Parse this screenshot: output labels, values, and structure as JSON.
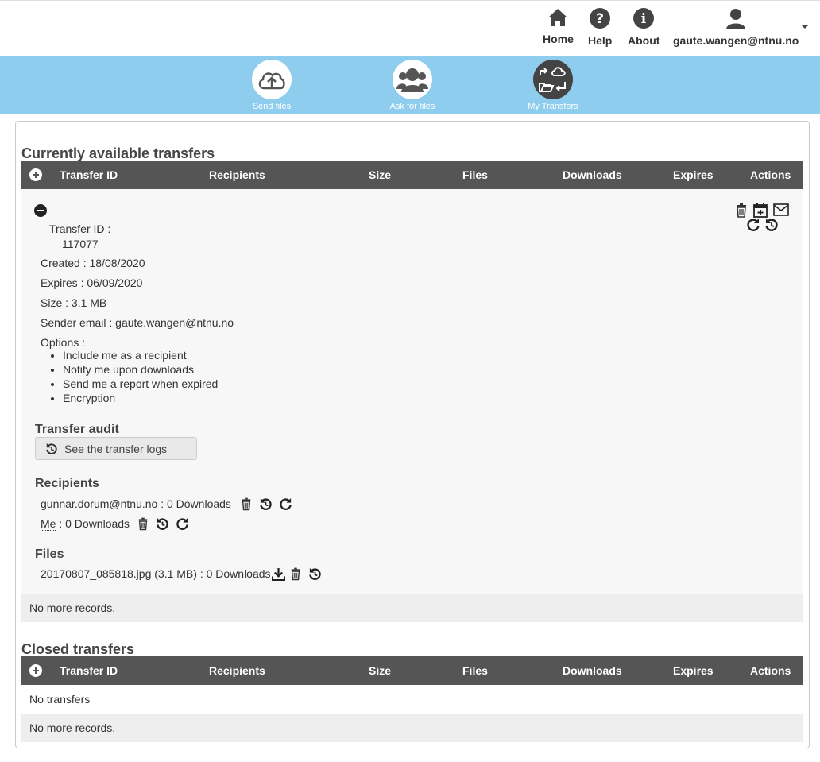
{
  "header": {
    "nav": [
      {
        "label": "Home",
        "icon": "home-icon"
      },
      {
        "label": "Help",
        "icon": "help-icon"
      },
      {
        "label": "About",
        "icon": "info-icon"
      },
      {
        "label": "gaute.wangen@ntnu.no",
        "icon": "user-icon"
      }
    ]
  },
  "toolbar": {
    "items": [
      {
        "label": "Send files",
        "icon": "cloud-upload-icon"
      },
      {
        "label": "Ask for files",
        "icon": "users-icon"
      },
      {
        "label": "My Transfers",
        "icon": "transfers-icon"
      }
    ]
  },
  "available": {
    "title": "Currently available transfers",
    "columns": [
      "Transfer ID",
      "Recipients",
      "Size",
      "Files",
      "Downloads",
      "Expires",
      "Actions"
    ],
    "transfer": {
      "id_label": "Transfer ID :",
      "id_value": "117077",
      "created": "Created : 18/08/2020",
      "expires": "Expires : 06/09/2020",
      "size": "Size : 3.1 MB",
      "sender": "Sender email : gaute.wangen@ntnu.no",
      "options_label": "Options :",
      "options": [
        "Include me as a recipient",
        "Notify me upon downloads",
        "Send me a report when expired",
        "Encryption"
      ]
    },
    "audit_title": "Transfer audit",
    "audit_button": "See the transfer logs",
    "recipients_title": "Recipients",
    "recipients": [
      {
        "name": "gunnar.dorum@ntnu.no",
        "downloads": " : 0 Downloads"
      },
      {
        "name": "Me",
        "downloads": " : 0 Downloads"
      }
    ],
    "files_title": "Files",
    "files": [
      {
        "text": "20170807_085818.jpg (3.1 MB) : 0 Downloads"
      }
    ],
    "no_more": "No more records."
  },
  "closed": {
    "title": "Closed transfers",
    "columns": [
      "Transfer ID",
      "Recipients",
      "Size",
      "Files",
      "Downloads",
      "Expires",
      "Actions"
    ],
    "empty": "No transfers",
    "no_more": "No more records."
  }
}
